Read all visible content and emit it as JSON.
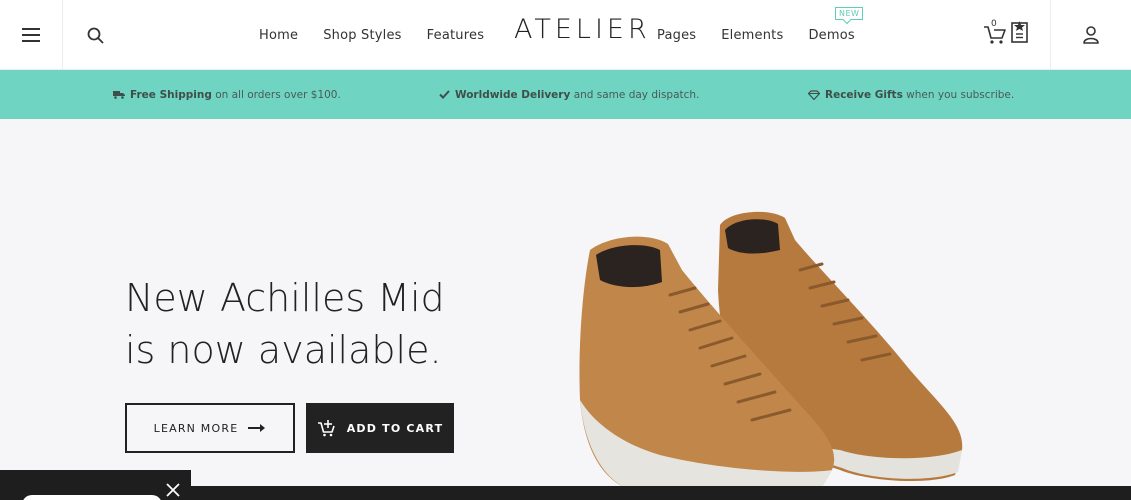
{
  "header": {
    "logo": "ATELIER",
    "nav_left": [
      {
        "label": "Home"
      },
      {
        "label": "Shop Styles"
      },
      {
        "label": "Features"
      }
    ],
    "nav_right": [
      {
        "label": "Pages"
      },
      {
        "label": "Elements"
      },
      {
        "label": "Demos"
      }
    ],
    "new_badge": "NEW",
    "cart_count": "0",
    "icons": [
      "menu-icon",
      "search-icon",
      "cart-icon",
      "wishlist-icon",
      "account-icon"
    ]
  },
  "infobar": {
    "items": [
      {
        "icon": "truck-icon",
        "bold": "Free Shipping",
        "text": "on all orders over $100."
      },
      {
        "icon": "check-icon",
        "bold": "Worldwide Delivery",
        "text": "and same day dispatch."
      },
      {
        "icon": "diamond-icon",
        "bold": "Receive Gifts",
        "text": "when you subscribe."
      }
    ],
    "color": "#6fd5c2"
  },
  "hero": {
    "headline_line1": "New Achilles Mid",
    "headline_line2": "is now available.",
    "learn_more_label": "LEARN MORE",
    "add_to_cart_label": "ADD TO CART",
    "image": "tan-suede-sneakers"
  }
}
